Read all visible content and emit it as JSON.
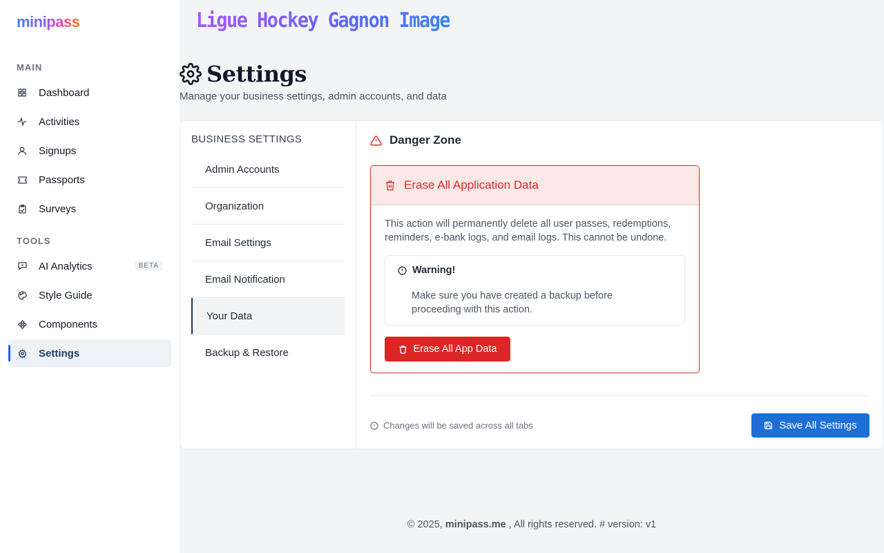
{
  "brand": {
    "logo_text": "minipass"
  },
  "sidebar": {
    "sections": [
      {
        "label": "MAIN"
      },
      {
        "label": "TOOLS"
      }
    ],
    "items": [
      {
        "label": "Dashboard",
        "icon": "grid-icon"
      },
      {
        "label": "Activities",
        "icon": "activity-icon"
      },
      {
        "label": "Signups",
        "icon": "user-icon"
      },
      {
        "label": "Passports",
        "icon": "ticket-icon"
      },
      {
        "label": "Surveys",
        "icon": "clipboard-icon"
      },
      {
        "label": "AI Analytics",
        "icon": "chat-icon",
        "badge": "BETA"
      },
      {
        "label": "Style Guide",
        "icon": "palette-icon"
      },
      {
        "label": "Components",
        "icon": "components-icon"
      },
      {
        "label": "Settings",
        "icon": "gear-icon",
        "active": true
      }
    ]
  },
  "header": {
    "org_name": "Ligue Hockey Gagnon Image"
  },
  "page": {
    "title": "Settings",
    "subtitle": "Manage your business settings, admin accounts, and data"
  },
  "settings_tabs": {
    "heading": "BUSINESS SETTINGS",
    "tabs": [
      {
        "label": "Admin Accounts"
      },
      {
        "label": "Organization"
      },
      {
        "label": "Email Settings"
      },
      {
        "label": "Email Notification"
      },
      {
        "label": "Your Data",
        "active": true
      },
      {
        "label": "Backup & Restore"
      }
    ]
  },
  "danger_zone": {
    "title": "Danger Zone",
    "box_title": "Erase All Application Data",
    "description": "This action will permanently delete all user passes, redemptions, reminders, e-bank logs, and email logs. This cannot be undone.",
    "warning_title": "Warning!",
    "warning_text": "Make sure you have created a backup before proceeding with this action.",
    "button_label": "Erase All App Data"
  },
  "save": {
    "note": "Changes will be saved across all tabs",
    "button_label": "Save All Settings"
  },
  "footer": {
    "prefix": "© 2025,",
    "brand": "minipass.me",
    "suffix": ", All rights reserved. # version: v1"
  },
  "colors": {
    "danger": "#dc2626",
    "primary": "#1d6fd6",
    "active_nav_bar": "#2563eb"
  }
}
